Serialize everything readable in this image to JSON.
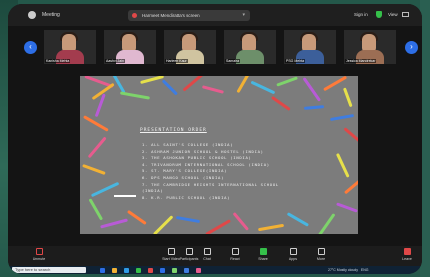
{
  "window": {
    "app_title": "Meeting",
    "meeting_info": "Harmeet Mendiratta's screen",
    "sign_in": "Sign in",
    "view": "View"
  },
  "participants": [
    {
      "name": "Kanisha Mehta",
      "body_color": "#a33c4e",
      "muted": true
    },
    {
      "name": "Aashvi Jain",
      "body_color": "#e0b8d0",
      "muted": true
    },
    {
      "name": "Harleen Kaur",
      "body_color": "#d0c4a0",
      "muted": true
    },
    {
      "name": "Samaira",
      "body_color": "#6d8f6a",
      "muted": true
    },
    {
      "name": "PSG Mehta",
      "body_color": "#3c5f9a",
      "muted": true
    },
    {
      "name": "Jessica Mandrekar",
      "body_color": "#9c6e54",
      "muted": true
    },
    {
      "name": "Harmeet Mendiratta",
      "body_color": "#d6d6d6",
      "muted": true
    }
  ],
  "slide": {
    "title": "PRESENTATION ORDER",
    "schools": [
      "1. ALL SAINT'S COLLEGE (INDIA)",
      "2. ASHRAM JUNIOR SCHOOL & HOSTEL (INDIA)",
      "3. THE ASHOKAN PUBLIC SCHOOL (INDIA)",
      "4. TRIVANDRUM INTERNATIONAL SCHOOL (INDIA)",
      "5. ST. MARY'S COLLEGE(INDIA)",
      "6. DPS MANGO SCHOOL (INDIA)",
      "7. THE CAMBRIDGE HEIGHTS INTERNATIONAL SCHOOL",
      "   (INDIA)",
      "8. K.R. PUBLIC SCHOOL (INDIA)"
    ]
  },
  "toolbar": {
    "items": [
      {
        "label": "Unmute",
        "key": "mute"
      },
      {
        "label": "Start Video",
        "key": "video"
      },
      {
        "label": "Participants",
        "key": "participants"
      },
      {
        "label": "Chat",
        "key": "chat"
      },
      {
        "label": "React",
        "key": "react"
      },
      {
        "label": "Share",
        "key": "share"
      },
      {
        "label": "Apps",
        "key": "apps"
      },
      {
        "label": "More",
        "key": "more"
      },
      {
        "label": "Leave",
        "key": "leave"
      }
    ]
  },
  "taskbar": {
    "search_placeholder": "Type here to search",
    "weather": "27°C Mostly cloudy",
    "language": "ENG"
  },
  "clip_colors": [
    "#e65c8e",
    "#f2b134",
    "#48b6e0",
    "#7ed36b",
    "#b85bd6",
    "#ff7b39",
    "#e6e04a",
    "#3f7de0",
    "#e04848"
  ]
}
